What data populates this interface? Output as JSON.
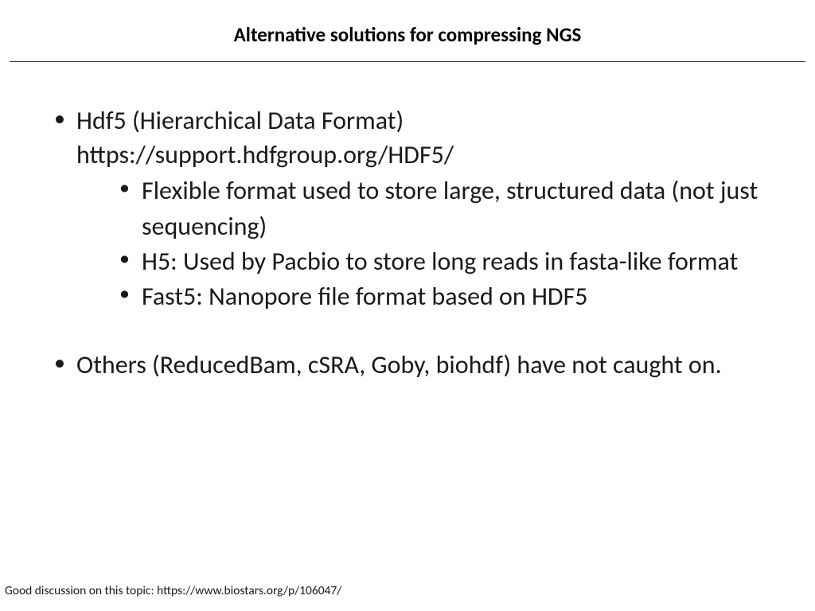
{
  "title": "Alternative solutions for compressing NGS",
  "bullets": {
    "item1": {
      "line1": "Hdf5 (Hierarchical Data Format)",
      "line2": "https://support.hdfgroup.org/HDF5/",
      "sub1": "Flexible format used to store large, structured data (not just sequencing)",
      "sub2": "H5: Used by Pacbio to store long reads in fasta-like format",
      "sub3": "Fast5: Nanopore file format based on HDF5"
    },
    "item2": {
      "text": "Others (ReducedBam, cSRA, Goby, biohdf) have not caught on."
    }
  },
  "footnote": "Good discussion on this topic: https://www.biostars.org/p/106047/"
}
